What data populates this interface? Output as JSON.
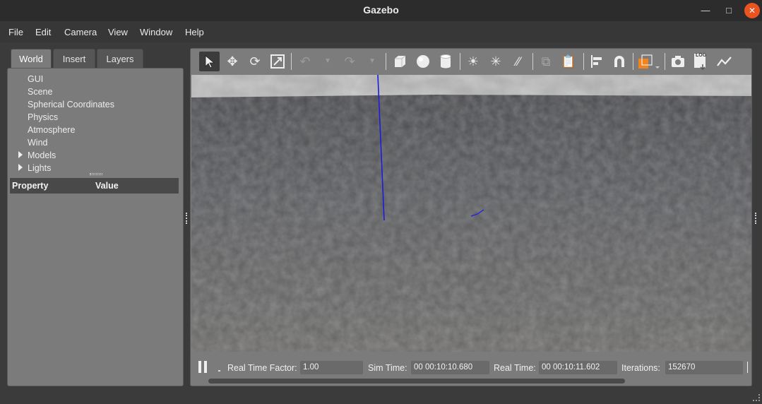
{
  "window": {
    "title": "Gazebo",
    "minimize_icon": "minimize-icon",
    "maximize_icon": "maximize-icon",
    "close_icon": "close-icon",
    "accent": "#e95420"
  },
  "menubar": {
    "items": [
      "File",
      "Edit",
      "Camera",
      "View",
      "Window",
      "Help"
    ]
  },
  "left_panel": {
    "tabs": [
      "World",
      "Insert",
      "Layers"
    ],
    "active_tab": "World",
    "tree": [
      {
        "label": "GUI",
        "expandable": false
      },
      {
        "label": "Scene",
        "expandable": false
      },
      {
        "label": "Spherical Coordinates",
        "expandable": false
      },
      {
        "label": "Physics",
        "expandable": false
      },
      {
        "label": "Atmosphere",
        "expandable": false
      },
      {
        "label": "Wind",
        "expandable": false
      },
      {
        "label": "Models",
        "expandable": true
      },
      {
        "label": "Lights",
        "expandable": true
      }
    ],
    "property_header": {
      "property": "Property",
      "value": "Value"
    }
  },
  "toolbar": {
    "tools": [
      "select-arrow-icon",
      "translate-icon",
      "rotate-icon",
      "scale-icon",
      "undo-icon",
      "redo-icon",
      "box-icon",
      "sphere-icon",
      "cylinder-icon",
      "point-light-icon",
      "spot-light-icon",
      "directional-light-icon",
      "copy-icon",
      "paste-icon",
      "align-icon",
      "snap-icon",
      "view-angle-icon",
      "screenshot-icon",
      "log-icon",
      "plot-icon"
    ],
    "active_tool": "select-arrow-icon",
    "log_badge": "LOG"
  },
  "status": {
    "paused_icon": "pause-icon",
    "real_time_factor_label": "Real Time Factor:",
    "real_time_factor": "1.00",
    "sim_time_label": "Sim Time:",
    "sim_time": "00 00:10:10.680",
    "real_time_label": "Real Time:",
    "real_time": "00 00:10:11.602",
    "iterations_label": "Iterations:",
    "iterations": "152670"
  }
}
